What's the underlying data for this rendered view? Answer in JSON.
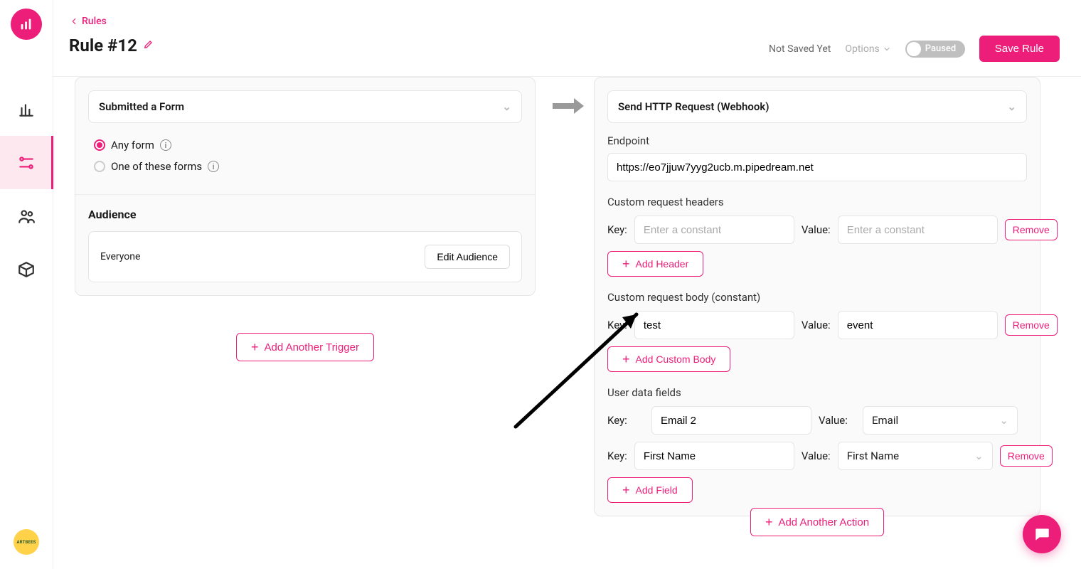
{
  "header": {
    "breadcrumb_label": "Rules",
    "title": "Rule #12",
    "not_saved": "Not Saved Yet",
    "options_label": "Options",
    "toggle_label": "Paused",
    "save_button": "Save Rule"
  },
  "trigger": {
    "select_label": "Submitted a Form",
    "radio_any": "Any form",
    "radio_one": "One of these forms",
    "audience_heading": "Audience",
    "audience_value": "Everyone",
    "edit_audience": "Edit Audience",
    "add_trigger": "Add Another Trigger"
  },
  "action": {
    "select_label": "Send HTTP Request (Webhook)",
    "endpoint_label": "Endpoint",
    "endpoint_value": "https://eo7jjuw7yyg2ucb.m.pipedream.net",
    "headers_heading": "Custom request headers",
    "key_label": "Key:",
    "value_label": "Value:",
    "placeholder_constant": "Enter a constant",
    "add_header": "Add Header",
    "body_heading": "Custom request body (constant)",
    "body_key": "test",
    "body_value": "event",
    "add_body": "Add Custom Body",
    "user_fields_heading": "User data fields",
    "uf_rows": [
      {
        "key": "Email 2",
        "value": "Email"
      },
      {
        "key": "First Name",
        "value": "First Name"
      }
    ],
    "add_field": "Add Field",
    "remove_label": "Remove",
    "add_action": "Add Another Action"
  },
  "sidebar_bottom_badge": "ARTBEES"
}
